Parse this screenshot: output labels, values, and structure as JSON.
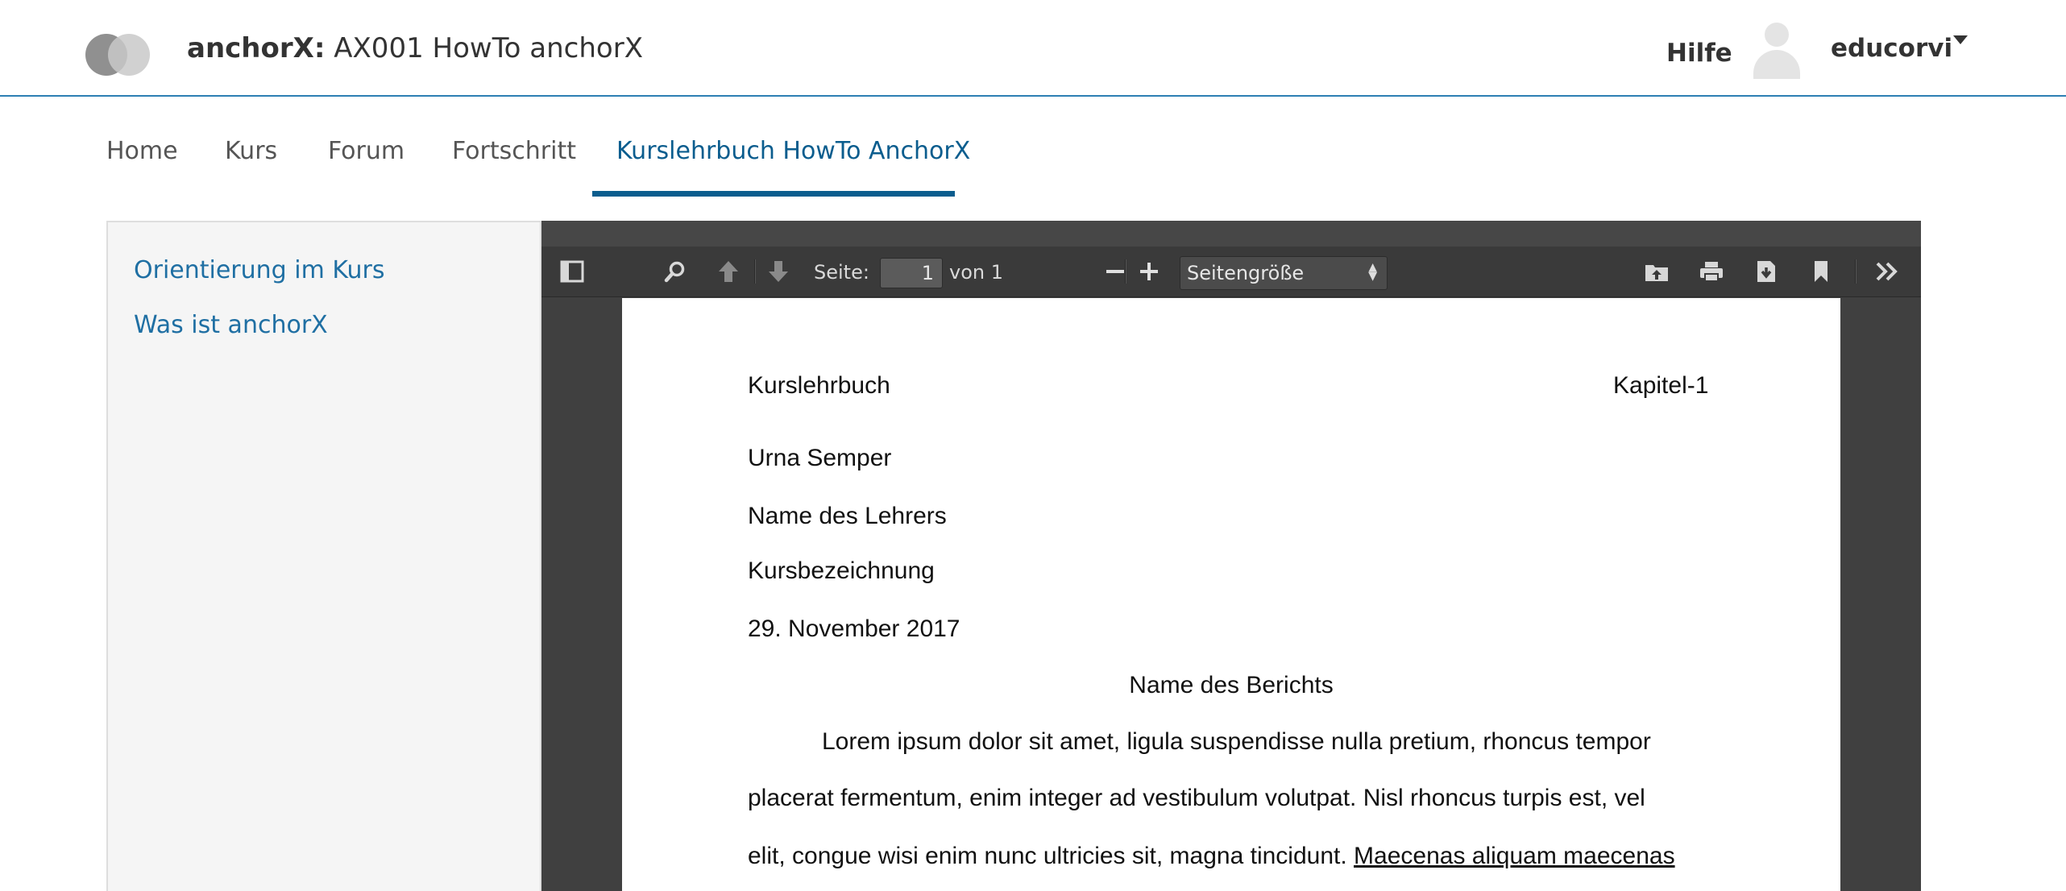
{
  "header": {
    "brand": "anchorX:",
    "course": " AX001 HowTo anchorX",
    "help": "Hilfe",
    "username": "educorvi"
  },
  "tabs": [
    {
      "label": "Home",
      "active": false
    },
    {
      "label": "Kurs",
      "active": false
    },
    {
      "label": "Forum",
      "active": false
    },
    {
      "label": "Fortschritt",
      "active": false
    },
    {
      "label": "Kurslehrbuch HowTo AnchorX",
      "active": true
    }
  ],
  "sidebar": {
    "links": [
      "Orientierung im Kurs",
      "Was ist anchorX"
    ]
  },
  "pdf_toolbar": {
    "page_label": "Seite:",
    "page_value": "1",
    "page_total": "von 1",
    "zoom": "Seitengröße",
    "icons": [
      "sidebar-toggle-icon",
      "search-icon",
      "previous-page-icon",
      "next-page-icon",
      "zoom-out-icon",
      "zoom-in-icon",
      "open-file-icon",
      "print-icon",
      "download-icon",
      "bookmark-icon",
      "tools-icon"
    ]
  },
  "document": {
    "header_left": "Kurslehrbuch",
    "header_right": "Kapitel-1",
    "author": "Urna Semper",
    "teacher": "Name des Lehrers",
    "course": "Kursbezeichnung",
    "date": "29. November 2017",
    "title": "Name des Berichts",
    "line1": "Lorem ipsum dolor sit amet, ligula suspendisse nulla pretium, rhoncus tempor",
    "line2": "placerat fermentum, enim integer ad vestibulum volutpat. Nisl rhoncus turpis est, vel",
    "line3": "elit, congue wisi enim nunc ultricies sit, magna tincidunt. ",
    "line3_link": "Maecenas aliquam maecenas"
  },
  "colors": {
    "accent": "#0b5d8e",
    "link": "#1f6fa3",
    "header_rule": "#2d7fb3",
    "viewer_bg": "#404040",
    "toolbar_bg": "#3a3a3a"
  }
}
